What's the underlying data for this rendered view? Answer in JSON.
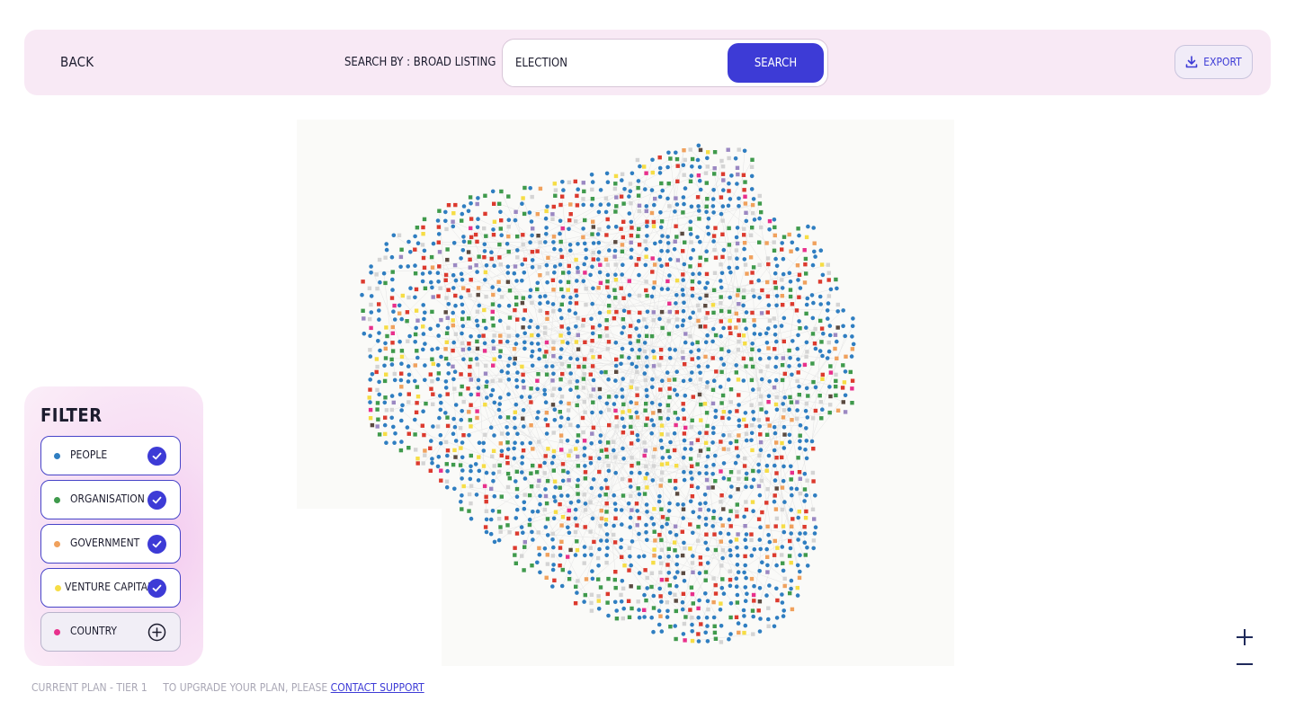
{
  "header": {
    "back_label": "BACK",
    "search_by_label": "SEARCH BY : BROAD LISTING",
    "search_value": "ELECTION",
    "search_button": "SEARCH",
    "export_button": "EXPORT"
  },
  "filter": {
    "title": "FILTER",
    "items": [
      {
        "label": "PEOPLE",
        "color": "#2f7ec1",
        "active": true
      },
      {
        "label": "ORGANISATION",
        "color": "#3f9a4c",
        "active": true
      },
      {
        "label": "GOVERNMENT",
        "color": "#f0a15d",
        "active": true
      },
      {
        "label": "VENTURE CAPITAL",
        "color": "#f6dd45",
        "active": true
      },
      {
        "label": "COUNTRY",
        "color": "#e8308c",
        "active": false
      }
    ]
  },
  "graph": {
    "background": "#fafaf8",
    "node_colors": {
      "people": "#2f7ec1",
      "organisation": "#3f9a4c",
      "government": "#f0a15d",
      "venture_capital": "#f6dd45",
      "country": "#e8308c",
      "red": "#dc3a2e",
      "grey": "#d4d4d4",
      "purple": "#9b88c2",
      "dark": "#5a4a40"
    }
  },
  "footer": {
    "plan_text": "CURRENT PLAN - TIER 1",
    "upgrade_text": "TO UPGRADE YOUR PLAN, PLEASE ",
    "support_link": "CONTACT SUPPORT"
  }
}
